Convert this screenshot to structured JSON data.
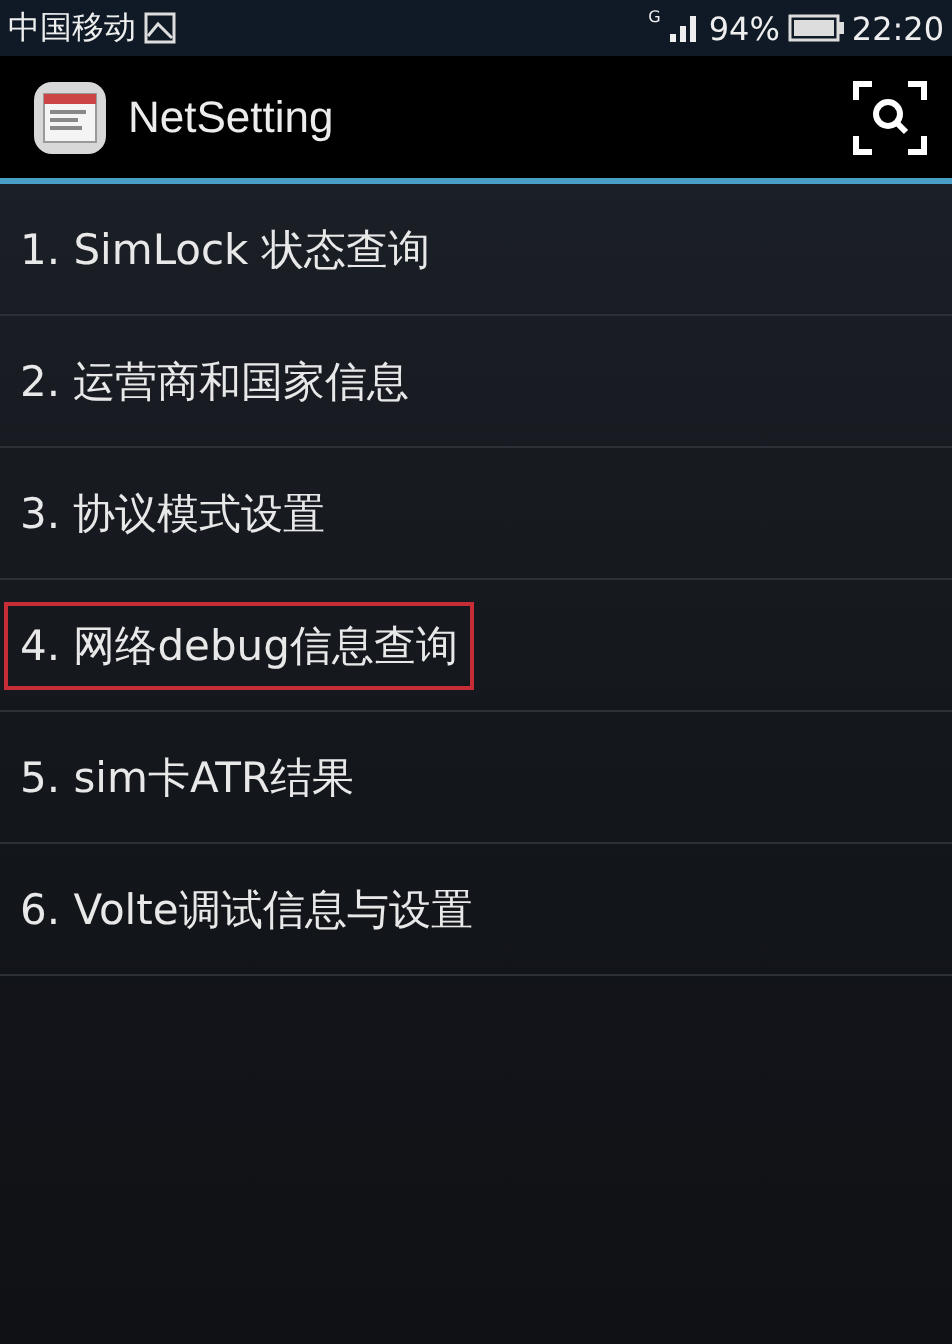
{
  "status_bar": {
    "carrier": "中国移动",
    "network_type": "G",
    "battery_percent": "94%",
    "time": "22:20"
  },
  "app_bar": {
    "title": "NetSetting"
  },
  "menu_items": [
    {
      "label": "1. SimLock 状态查询",
      "highlighted": false
    },
    {
      "label": "2. 运营商和国家信息",
      "highlighted": false
    },
    {
      "label": "3. 协议模式设置",
      "highlighted": false
    },
    {
      "label": "4. 网络debug信息查询",
      "highlighted": true
    },
    {
      "label": "5. sim卡ATR结果",
      "highlighted": false
    },
    {
      "label": "6. Volte调试信息与设置",
      "highlighted": false
    }
  ]
}
